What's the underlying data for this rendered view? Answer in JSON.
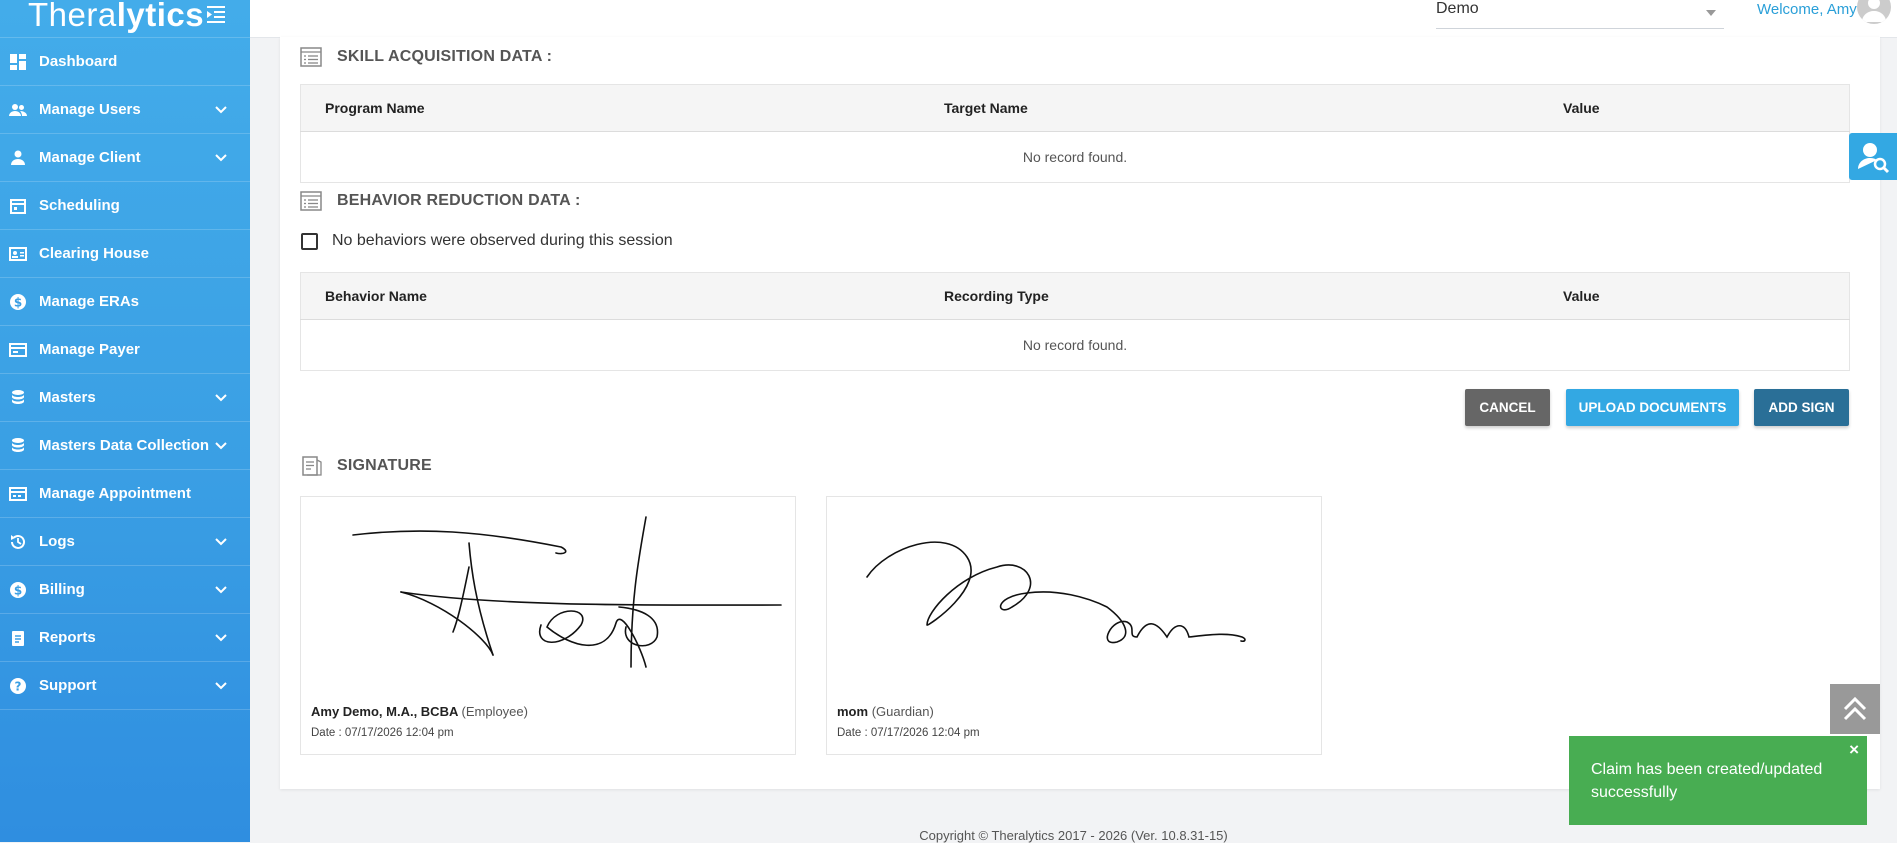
{
  "brand": {
    "prefix": "Thera",
    "suffix": "lytics"
  },
  "sidebar": {
    "items": [
      {
        "label": "Dashboard",
        "icon": "dashboard-icon",
        "expandable": false
      },
      {
        "label": "Manage Users",
        "icon": "users-icon",
        "expandable": true
      },
      {
        "label": "Manage Client",
        "icon": "person-icon",
        "expandable": true
      },
      {
        "label": "Scheduling",
        "icon": "calendar-icon",
        "expandable": false
      },
      {
        "label": "Clearing House",
        "icon": "id-card-icon",
        "expandable": false
      },
      {
        "label": "Manage ERAs",
        "icon": "dollar-icon",
        "expandable": false
      },
      {
        "label": "Manage Payer",
        "icon": "payer-icon",
        "expandable": false
      },
      {
        "label": "Masters",
        "icon": "database-icon",
        "expandable": true
      },
      {
        "label": "Masters Data Collection",
        "icon": "database-icon",
        "expandable": true
      },
      {
        "label": "Manage Appointment",
        "icon": "appointment-icon",
        "expandable": false
      },
      {
        "label": "Logs",
        "icon": "history-icon",
        "expandable": true
      },
      {
        "label": "Billing",
        "icon": "dollar-icon",
        "expandable": true
      },
      {
        "label": "Reports",
        "icon": "clipboard-icon",
        "expandable": true
      },
      {
        "label": "Support",
        "icon": "help-icon",
        "expandable": true
      }
    ]
  },
  "topbar": {
    "org_value": "Demo",
    "welcome": "Welcome, Amy"
  },
  "skill": {
    "title": "SKILL ACQUISITION DATA :",
    "columns": [
      "Program Name",
      "Target Name",
      "Value"
    ],
    "empty": "No record found."
  },
  "behavior": {
    "title": "BEHAVIOR REDUCTION DATA :",
    "checkbox_label": "No behaviors were observed during this session",
    "columns": [
      "Behavior Name",
      "Recording Type",
      "Value"
    ],
    "empty": "No record found."
  },
  "actions": {
    "cancel": "CANCEL",
    "upload": "UPLOAD DOCUMENTS",
    "add_sign": "ADD SIGN"
  },
  "signature": {
    "title": "SIGNATURE",
    "cards": [
      {
        "name": "Amy Demo, M.A., BCBA",
        "role": "(Employee)",
        "date": "Date : 07/17/2026 12:04 pm"
      },
      {
        "name": "mom",
        "role": "(Guardian)",
        "date": "Date : 07/17/2026 12:04 pm"
      }
    ]
  },
  "toast": {
    "message": "Claim has been created/updated successfully",
    "close": "×"
  },
  "footer": "Copyright © Theralytics 2017 - 2026 (Ver. 10.8.31-15)",
  "colors": {
    "sidebar": "#3a9fe4",
    "primary": "#33a8e3",
    "dark_primary": "#2a6f97",
    "success": "#48ad52"
  }
}
